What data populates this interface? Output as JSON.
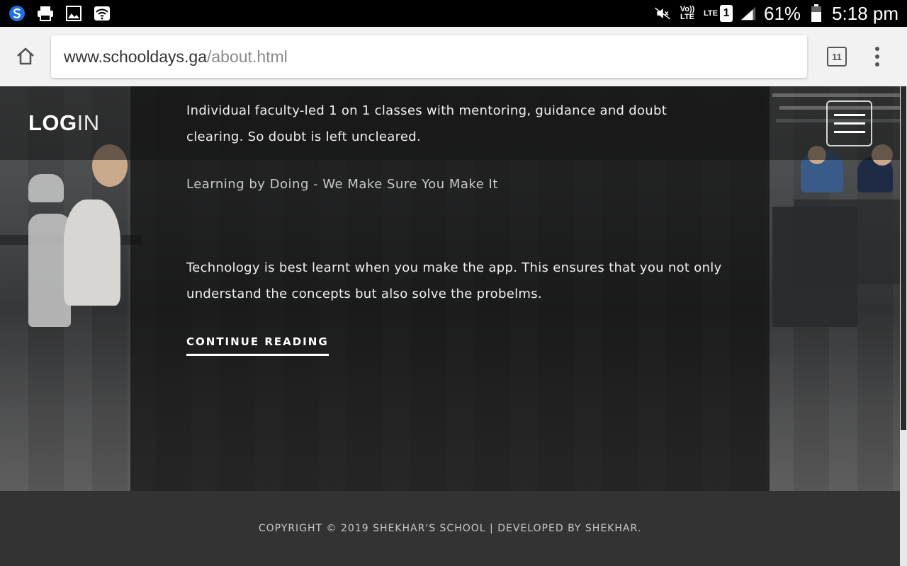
{
  "status_bar": {
    "battery": "61%",
    "time": "5:18 pm",
    "network": "LTE",
    "volte": "Vo)) LTE",
    "sim": "1"
  },
  "browser": {
    "url_host": "www.schooldays.ga",
    "url_path": "/about.html",
    "tab_count": "11"
  },
  "site": {
    "logo_bold": "LOG",
    "logo_light": "IN"
  },
  "content": {
    "paragraph_1": "Individual faculty-led 1 on 1 classes with mentoring, guidance and doubt clearing. So doubt is left uncleared.",
    "subtitle": "Learning by Doing - We Make Sure You Make It",
    "paragraph_2": "Technology is best learnt when you make the app. This ensures that you not only understand the concepts but also solve the probelms.",
    "continue_label": "CONTINUE READING"
  },
  "footer": {
    "copyright": "COPYRIGHT © 2019 SHEKHAR'S SCHOOL | DEVELOPED BY SHEKHAR."
  },
  "icons": [
    "app-s-icon",
    "printer-icon",
    "image-icon",
    "wifi-hotspot-icon",
    "mute-icon",
    "signal-icon",
    "battery-icon",
    "home-icon",
    "tab-switcher-icon",
    "more-vert-icon",
    "hamburger-icon"
  ]
}
